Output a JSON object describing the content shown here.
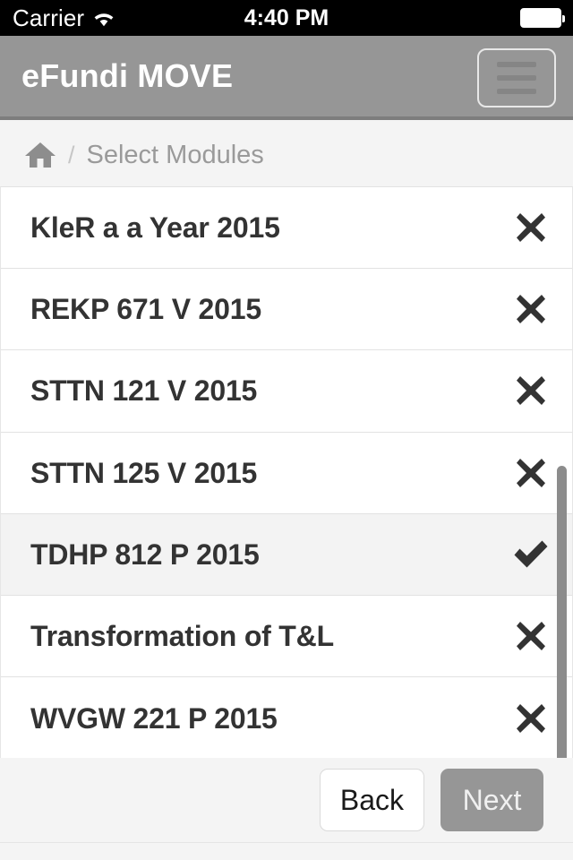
{
  "status_bar": {
    "carrier": "Carrier",
    "wifi_icon": "wifi-icon",
    "time": "4:40 PM",
    "battery_icon": "battery-full-icon"
  },
  "navbar": {
    "brand": "eFundi MOVE",
    "menu_icon": "hamburger-menu-icon",
    "background": "#969696"
  },
  "breadcrumb": {
    "home_icon": "home-icon",
    "separator": "/",
    "current": "Select Modules"
  },
  "module_list": {
    "rows": [
      {
        "label": "KleR a a Year 2015",
        "state": "unselected",
        "state_glyph": "x-icon",
        "selected": false
      },
      {
        "label": "REKP 671 V 2015",
        "state": "unselected",
        "state_glyph": "x-icon",
        "selected": false
      },
      {
        "label": "STTN 121 V 2015",
        "state": "unselected",
        "state_glyph": "x-icon",
        "selected": false
      },
      {
        "label": "STTN 125 V 2015",
        "state": "unselected",
        "state_glyph": "x-icon",
        "selected": false
      },
      {
        "label": "TDHP 812 P 2015",
        "state": "selected",
        "state_glyph": "check-icon",
        "selected": true
      },
      {
        "label": "Transformation of T&L",
        "state": "unselected",
        "state_glyph": "x-icon",
        "selected": false
      },
      {
        "label": "WVGW 221 P 2015",
        "state": "unselected",
        "state_glyph": "x-icon",
        "selected": false
      }
    ]
  },
  "scrollbar": {
    "name": "vertical-scrollbar-thumb"
  },
  "footer": {
    "back_label": "Back",
    "next_label": "Next",
    "next_background": "#969696"
  }
}
